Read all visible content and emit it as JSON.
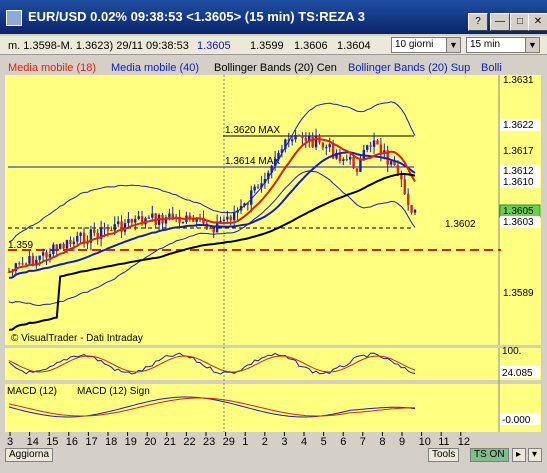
{
  "window": {
    "title": "EUR/USD 0.02% 09:38:53  <1.3605> (15 min) TS:REZA 3",
    "buttons": [
      "?",
      "—",
      "□",
      "✕"
    ]
  },
  "quote_bar": {
    "range": "m. 1.3598-M. 1.3623) 29/11 09:38:53",
    "last": "1.3605",
    "bid": "1.3599",
    "high": "1.3606",
    "low": "1.3604",
    "period_select": "10 giorni",
    "interval_select": "15 min"
  },
  "legend": [
    {
      "label": "Media mobile (18)",
      "color": "#e02010"
    },
    {
      "label": "Media mobile (40)",
      "color": "#1020c0"
    },
    {
      "label": "Bollinger Bands (20) Cen",
      "color": "#000000"
    },
    {
      "label": "Bollinger Bands (20) Sup",
      "color": "#1020c0"
    },
    {
      "label": "Bolli",
      "color": "#1020c0"
    }
  ],
  "price_axis": {
    "ticks": [
      "1.3631",
      "1.3622",
      "1.3617",
      "1.3612",
      "1.3610",
      "1.3605",
      "1.3603",
      "1.3589"
    ],
    "tick_colors": [
      "#000000",
      "#000000",
      "#000000",
      "#000000",
      "#e02010",
      "#000000",
      "#000000",
      "#000000"
    ],
    "tick_bgs": [
      "none",
      "#ffffff",
      "none",
      "#ffffff",
      "#ffffff",
      "#6ad14d",
      "#ffffff",
      "none"
    ]
  },
  "annotations": {
    "max1": "1.3620 MAX",
    "max2": "1.3614 MAX",
    "level": "1.3602",
    "left_level": "1.359",
    "watermark": "© VisualTrader - Dati Intraday"
  },
  "osc1": {
    "axis_top": "100.",
    "value": "24.085"
  },
  "macd": {
    "label1": "MACD (12)",
    "label2": "MACD (12) Sign",
    "value": "-0.000"
  },
  "x_axis": {
    "labels": [
      "3",
      "14",
      "15",
      "16",
      "17",
      "18",
      "19",
      "20",
      "21",
      "22",
      "23",
      "29",
      "1",
      "2",
      "3",
      "4",
      "5",
      "6",
      "7",
      "8",
      "9",
      "10",
      "11",
      "12"
    ],
    "highlight": "29"
  },
  "footer": {
    "refresh": "Aggiorna",
    "tools": "Tools",
    "ts": "TS ON"
  },
  "colors": {
    "chart_bg": "#ffff80",
    "ma18": "#e02010",
    "ma40": "#1020c0",
    "center": "#000000",
    "bands": "#1020c0"
  }
}
